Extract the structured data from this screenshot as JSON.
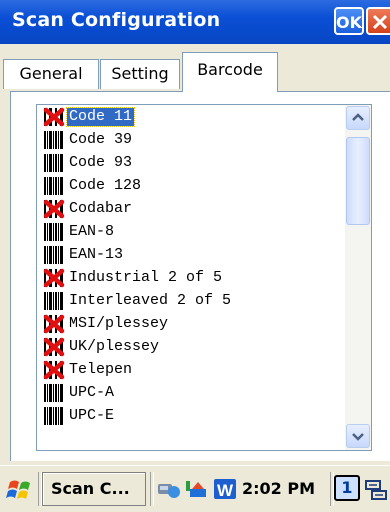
{
  "window": {
    "title": "Scan Configuration",
    "ok_label": "OK"
  },
  "tabs": [
    {
      "label": "General",
      "active": false
    },
    {
      "label": "Setting",
      "active": false
    },
    {
      "label": "Barcode",
      "active": true
    }
  ],
  "barcodes": [
    {
      "label": "Code 11",
      "enabled": false,
      "selected": true
    },
    {
      "label": "Code 39",
      "enabled": true
    },
    {
      "label": "Code 93",
      "enabled": true
    },
    {
      "label": "Code 128",
      "enabled": true
    },
    {
      "label": "Codabar",
      "enabled": false
    },
    {
      "label": "EAN-8",
      "enabled": true
    },
    {
      "label": "EAN-13",
      "enabled": true
    },
    {
      "label": "Industrial 2 of 5",
      "enabled": false
    },
    {
      "label": "Interleaved 2 of 5",
      "enabled": true
    },
    {
      "label": "MSI/plessey",
      "enabled": false
    },
    {
      "label": "UK/plessey",
      "enabled": false
    },
    {
      "label": "Telepen",
      "enabled": false
    },
    {
      "label": "UPC-A",
      "enabled": true
    },
    {
      "label": "UPC-E",
      "enabled": true
    }
  ],
  "taskbar": {
    "start_icon": "windows-flag-icon",
    "task_label": "Scan C...",
    "tray_icons": [
      "bluetooth-connection-icon",
      "network-share-icon",
      "word-icon"
    ],
    "clock": "2:02 PM",
    "badge": "1",
    "input_icon": "keyboard-input-icon"
  },
  "colors": {
    "title_bar": "#0a4fd6",
    "selection": "#316ac5",
    "disabled_mark": "#e01010"
  }
}
